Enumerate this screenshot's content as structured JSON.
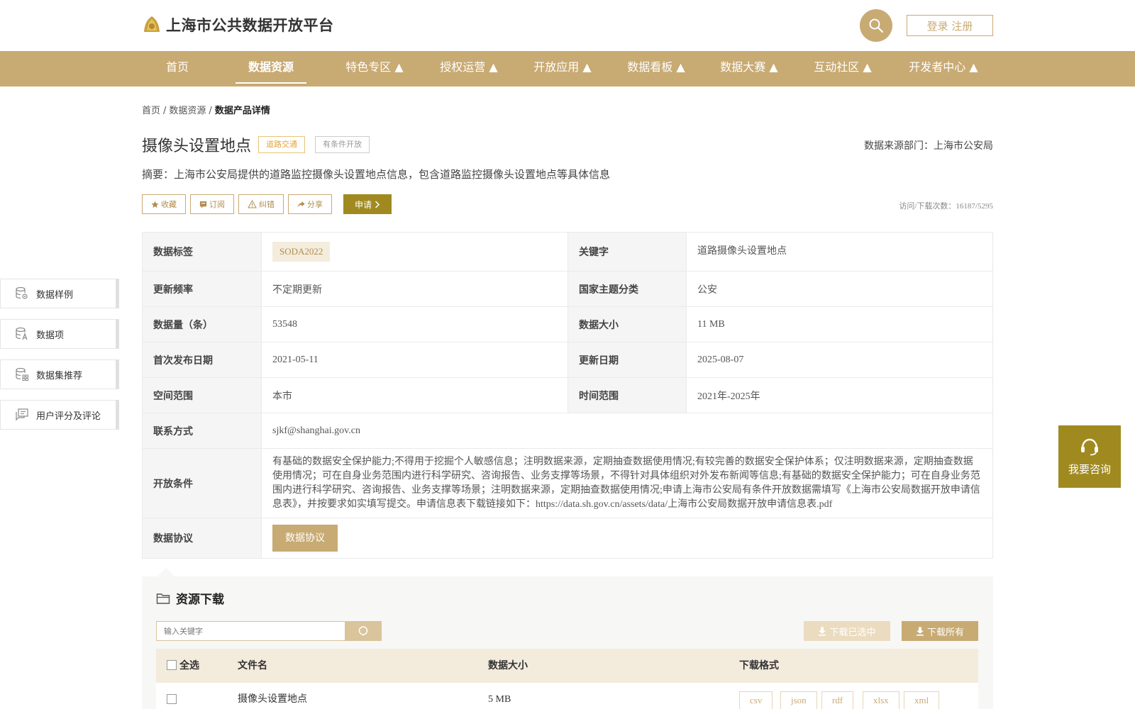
{
  "header": {
    "logo_text": "上海市公共数据开放平台",
    "login_label": "登录 注册"
  },
  "nav": {
    "items": [
      "首页",
      "数据资源",
      "特色专区 ▲",
      "授权运营 ▲",
      "开放应用 ▲",
      "数据看板 ▲",
      "数据大赛 ▲",
      "互动社区 ▲",
      "开发者中心 ▲"
    ],
    "active": "数据资源"
  },
  "breadcrumb": {
    "home": "首页",
    "resources": "数据资源",
    "current": "数据产品详情",
    "sep": "/"
  },
  "product": {
    "title": "摄像头设置地点",
    "tag_category": "道路交通",
    "tag_open": "有条件开放",
    "source_dept": "数据来源部门：上海市公安局",
    "summary": "摘要：上海市公安局提供的道路监控摄像头设置地点信息，包含道路监控摄像头设置地点等具体信息",
    "visits": "访问/下载次数：16187/5295"
  },
  "actions": {
    "favorite": "收藏",
    "subscribe": "订阅",
    "report": "纠错",
    "share": "分享",
    "apply": "申请"
  },
  "info": {
    "tag_label": "数据标签",
    "tag_value": "SODA2022",
    "keyword_label": "关键字",
    "keyword_value": "道路摄像头设置地点",
    "freq_label": "更新频率",
    "freq_value": "不定期更新",
    "theme_label": "国家主题分类",
    "theme_value": "公安",
    "count_label": "数据量（条）",
    "count_value": "53548",
    "size_label": "数据大小",
    "size_value": "11 MB",
    "first_pub_label": "首次发布日期",
    "first_pub_value": "2021-05-11",
    "update_label": "更新日期",
    "update_value": "2025-08-07",
    "space_label": "空间范围",
    "space_value": "本市",
    "time_label": "时间范围",
    "time_value": "2021年-2025年",
    "contact_label": "联系方式",
    "contact_value": "sjkf@shanghai.gov.cn",
    "cond_label": "开放条件",
    "cond_value": "有基础的数据安全保护能力;不得用于挖掘个人敏感信息；注明数据来源，定期抽查数据使用情况;有较完善的数据安全保护体系；仅注明数据来源，定期抽查数据使用情况；可在自身业务范围内进行科学研究、咨询报告、业务支撑等场景，不得针对具体组织对外发布新闻等信息;有基础的数据安全保护能力；可在自身业务范围内进行科学研究、咨询报告、业务支撑等场景；注明数据来源，定期抽查数据使用情况;申请上海市公安局有条件开放数据需填写《上海市公安局数据开放申请信息表》，并按要求如实填写提交。申请信息表下载链接如下：https://data.sh.gov.cn/assets/data/上海市公安局数据开放申请信息表.pdf",
    "protocol_label": "数据协议",
    "protocol_button": "数据协议"
  },
  "side_menu": [
    "数据样例",
    "数据项",
    "数据集推荐",
    "用户评分及评论"
  ],
  "consult": {
    "label": "我要咨询"
  },
  "resources": {
    "title": "资源下载",
    "search_placeholder": "输入关键字",
    "download_selected": "下载已选中",
    "download_all": "下载所有",
    "columns": {
      "select_all": "全选",
      "filename": "文件名",
      "size": "数据大小",
      "format": "下载格式"
    },
    "rows": [
      {
        "filename": "摄像头设置地点",
        "size": "5 MB",
        "formats": [
          "csv",
          "json",
          "rdf",
          "xlsx",
          "xml"
        ]
      }
    ]
  },
  "colors": {
    "brand": "#c8aa73",
    "accent_dark": "#a08a20"
  }
}
